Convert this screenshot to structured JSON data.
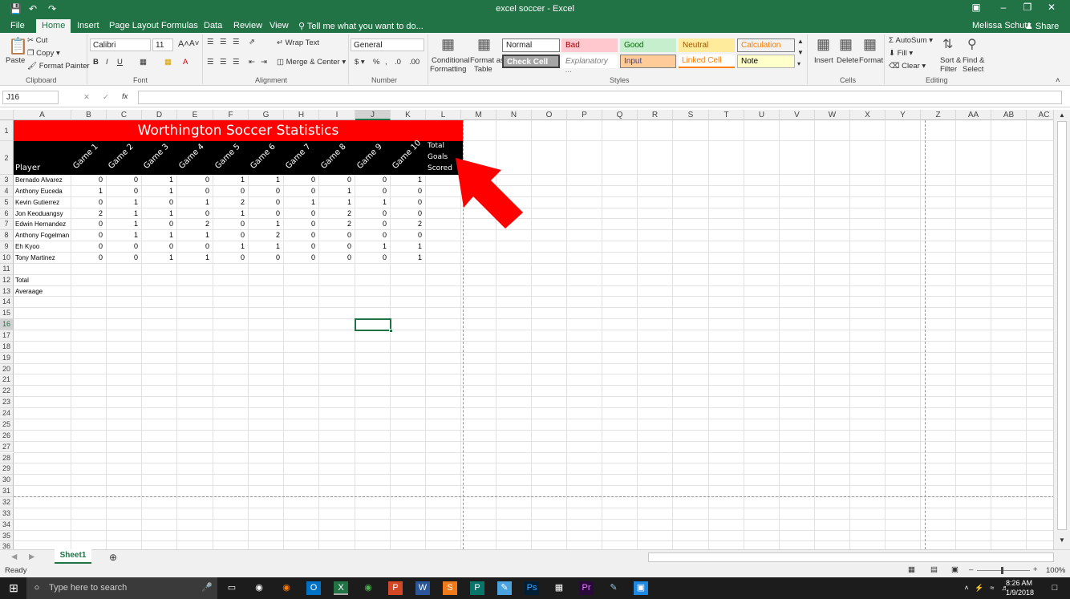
{
  "titlebar": {
    "doc_title": "excel soccer - Excel",
    "user": "Melissa Schutz",
    "share": "Share"
  },
  "tabs": [
    "File",
    "Home",
    "Insert",
    "Page Layout",
    "Formulas",
    "Data",
    "Review",
    "View"
  ],
  "tell_me": "Tell me what you want to do...",
  "ribbon": {
    "paste": "Paste",
    "cut": "Cut",
    "copy": "Copy",
    "format_painter": "Format Painter",
    "font_name": "Calibri",
    "font_size": "11",
    "wrap_text": "Wrap Text",
    "merge_center": "Merge & Center",
    "number_format": "General",
    "cond_format": [
      "Conditional",
      "Formatting"
    ],
    "format_table": [
      "Format as",
      "Table"
    ],
    "styles": [
      "Normal",
      "Bad",
      "Good",
      "Neutral",
      "Calculation",
      "Check Cell",
      "Explanatory ...",
      "Input",
      "Linked Cell",
      "Note"
    ],
    "insert": "Insert",
    "delete": "Delete",
    "format": "Format",
    "autosum": "AutoSum",
    "fill": "Fill",
    "clear": "Clear",
    "sort_filter": [
      "Sort &",
      "Filter"
    ],
    "find_select": [
      "Find &",
      "Select"
    ],
    "groups": [
      "Clipboard",
      "Font",
      "Alignment",
      "Number",
      "Styles",
      "Cells",
      "Editing"
    ]
  },
  "name_box": "J16",
  "columns": [
    "A",
    "B",
    "C",
    "D",
    "E",
    "F",
    "G",
    "H",
    "I",
    "J",
    "K",
    "L",
    "M",
    "N",
    "O",
    "P",
    "Q",
    "R",
    "S",
    "T",
    "U",
    "V",
    "W",
    "X",
    "Y",
    "Z",
    "AA",
    "AB",
    "AC"
  ],
  "sheet": {
    "title": "Worthington Soccer Statistics",
    "player_header": "Player",
    "games": [
      "Game 1",
      "Game 2",
      "Game 3",
      "Game 4",
      "Game 5",
      "Game 6",
      "Game 7",
      "Game 8",
      "Game 9",
      "Game 10"
    ],
    "total_header": [
      "Total",
      "Goals",
      "Scored"
    ],
    "players": [
      {
        "name": "Bernado Alvarez",
        "goals": [
          0,
          0,
          1,
          0,
          1,
          1,
          0,
          0,
          0,
          1
        ]
      },
      {
        "name": "Anthony Euceda",
        "goals": [
          1,
          0,
          1,
          0,
          0,
          0,
          0,
          1,
          0,
          0
        ]
      },
      {
        "name": "Kevin Gutierrez",
        "goals": [
          0,
          1,
          0,
          1,
          2,
          0,
          1,
          1,
          1,
          0
        ]
      },
      {
        "name": "Jon Keoduangsy",
        "goals": [
          2,
          1,
          1,
          0,
          1,
          0,
          0,
          2,
          0,
          0
        ]
      },
      {
        "name": "Edwin Hernandez",
        "goals": [
          0,
          1,
          0,
          2,
          0,
          1,
          0,
          2,
          0,
          2
        ]
      },
      {
        "name": "Anthony Fogelman",
        "goals": [
          0,
          1,
          1,
          1,
          0,
          2,
          0,
          0,
          0,
          0
        ]
      },
      {
        "name": "Eh Kyoo",
        "goals": [
          0,
          0,
          0,
          0,
          1,
          1,
          0,
          0,
          1,
          1
        ]
      },
      {
        "name": "Tony Martinez",
        "goals": [
          0,
          0,
          1,
          1,
          0,
          0,
          0,
          0,
          0,
          1
        ]
      }
    ],
    "total_label": "Total",
    "average_label": "Averaage"
  },
  "sheet_tab": "Sheet1",
  "status": {
    "ready": "Ready",
    "zoom": "100%"
  },
  "taskbar": {
    "search": "Type here to search",
    "time": "8:26 AM",
    "date": "1/9/2018"
  },
  "colors": {
    "excel_green": "#217346",
    "title_red": "#ff0000",
    "header_black": "#000000",
    "arrow_red": "#ff0000"
  }
}
